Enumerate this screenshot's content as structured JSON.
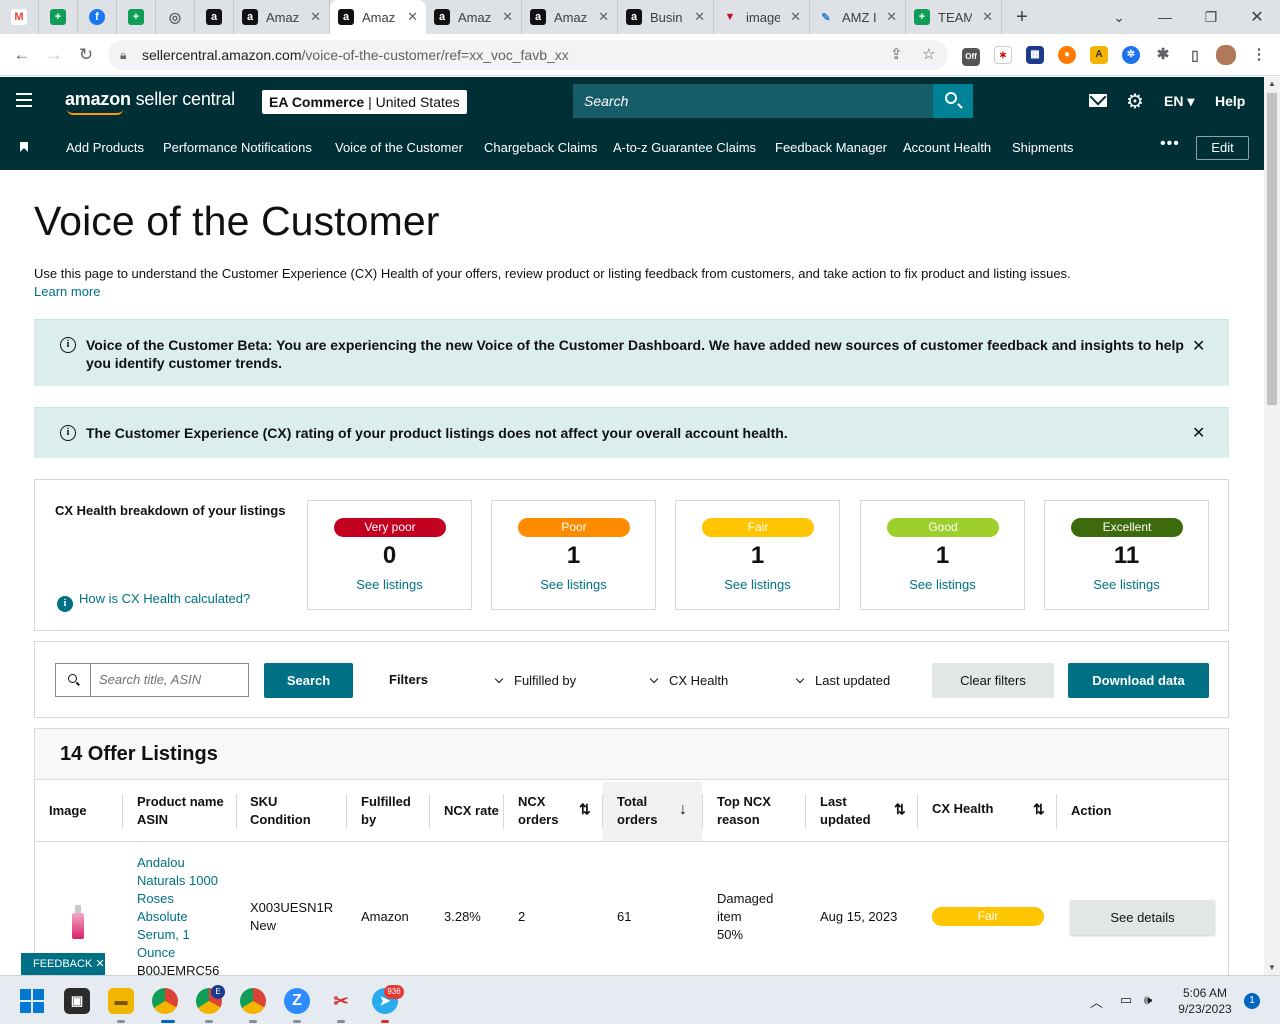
{
  "browser": {
    "tabs": [
      {
        "title": "",
        "icon": "gmail-icon",
        "color": "#ea4335",
        "glyph": "M"
      },
      {
        "title": "",
        "icon": "sheets-icon",
        "color": "#0f9d58",
        "glyph": "+"
      },
      {
        "title": "",
        "icon": "facebook-icon",
        "color": "#1877f2",
        "glyph": "f"
      },
      {
        "title": "",
        "icon": "sheets-icon",
        "color": "#0f9d58",
        "glyph": "+"
      },
      {
        "title": "",
        "icon": "globe-icon",
        "color": "#5f6368",
        "glyph": "◎"
      },
      {
        "title": "",
        "icon": "amazon-icon",
        "color": "#111111",
        "glyph": "a"
      },
      {
        "title": "Amaz",
        "icon": "amazon-icon",
        "color": "#111111",
        "glyph": "a"
      },
      {
        "title": "Amaz",
        "icon": "amazon-icon",
        "color": "#111111",
        "glyph": "a"
      },
      {
        "title": "Amaz",
        "icon": "amazon-icon",
        "color": "#111111",
        "glyph": "a"
      },
      {
        "title": "Amaz",
        "icon": "amazon-icon",
        "color": "#111111",
        "glyph": "a"
      },
      {
        "title": "Busin",
        "icon": "amazon-icon",
        "color": "#111111",
        "glyph": "a"
      },
      {
        "title": "image",
        "icon": "image-tool-icon",
        "color": "#c0142b",
        "glyph": "▼"
      },
      {
        "title": "AMZ I",
        "icon": "pen-icon",
        "color": "#2a7fd4",
        "glyph": "✎"
      },
      {
        "title": "TEAM",
        "icon": "sheets-icon",
        "color": "#0f9d58",
        "glyph": "+"
      }
    ],
    "url_host": "sellercentral.amazon.com",
    "url_path": "/voice-of-the-customer/ref=xx_voc_favb_xx",
    "ext_off_label": "Off"
  },
  "header": {
    "logo_bold": "amazon",
    "logo_rest": " seller central",
    "store_name": "EA Commerce",
    "store_region": "United States",
    "search_placeholder": "Search",
    "lang": "EN",
    "help": "Help"
  },
  "nav": {
    "items": [
      "Add Products",
      "Performance Notifications",
      "Voice of the Customer",
      "Chargeback Claims",
      "A-to-z Guarantee Claims",
      "Feedback Manager",
      "Account Health",
      "Shipments"
    ],
    "more": "•••",
    "edit": "Edit"
  },
  "page": {
    "title": "Voice of the Customer",
    "intro": "Use this page to understand the Customer Experience (CX) Health of your offers, review product or listing feedback from customers, and take action to fix product and listing issues.",
    "learn_more": "Learn more",
    "alert1": "Voice of the Customer Beta: You are experiencing the new Voice of the Customer Dashboard. We have added new sources of customer feedback and insights to help you identify customer trends.",
    "alert2": "The Customer Experience (CX) rating of your product listings does not affect your overall account health."
  },
  "cx": {
    "label": "CX Health breakdown of your listings",
    "how": "How is CX Health calculated?",
    "see_listings": "See listings",
    "cards": [
      {
        "label": "Very poor",
        "count": "0",
        "color": "#c40021",
        "text": "#ffffff"
      },
      {
        "label": "Poor",
        "count": "1",
        "color": "#ff8c00",
        "text": "#ffffff"
      },
      {
        "label": "Fair",
        "count": "1",
        "color": "#ffc500",
        "text": "#ffffff"
      },
      {
        "label": "Good",
        "count": "1",
        "color": "#9ed02c",
        "text": "#ffffff"
      },
      {
        "label": "Excellent",
        "count": "11",
        "color": "#3d6a0d",
        "text": "#ffffff"
      }
    ]
  },
  "filters": {
    "search_placeholder": "Search title, ASIN",
    "search_btn": "Search",
    "label": "Filters",
    "fulfilled_by": "Fulfilled by",
    "cx_health": "CX Health",
    "last_updated": "Last updated",
    "clear": "Clear filters",
    "download": "Download data"
  },
  "table": {
    "title": "14 Offer Listings",
    "columns": {
      "image": "Image",
      "product_1": "Product name",
      "product_2": "ASIN",
      "sku_1": "SKU",
      "sku_2": "Condition",
      "fulfilled_1": "Fulfilled",
      "fulfilled_2": "by",
      "ncx_rate": "NCX rate",
      "ncx_orders_1": "NCX",
      "ncx_orders_2": "orders",
      "total_orders_1": "Total",
      "total_orders_2": "orders",
      "reason_1": "Top NCX",
      "reason_2": "reason",
      "updated_1": "Last",
      "updated_2": "updated",
      "cx_health": "CX Health",
      "action": "Action"
    },
    "rows": [
      {
        "name_lines": [
          "Andalou",
          "Naturals 1000",
          "Roses",
          "Absolute",
          "Serum, 1",
          "Ounce"
        ],
        "asin": "B00JEMRC56",
        "sku": "X003UESN1R",
        "condition": "New",
        "fulfilled_by": "Amazon",
        "ncx_rate": "3.28%",
        "ncx_orders": "2",
        "total_orders": "61",
        "reason": "Damaged",
        "reason_2": "item",
        "reason_pct": "50%",
        "last_updated": "Aug 15, 2023",
        "cx_health": "Fair",
        "action": "See details"
      }
    ]
  },
  "feedback": "FEEDBACK",
  "taskbar": {
    "time": "5:06 AM",
    "date": "9/23/2023",
    "telegram_badge": "936",
    "chrome_badge": "E",
    "notifications": "1"
  }
}
